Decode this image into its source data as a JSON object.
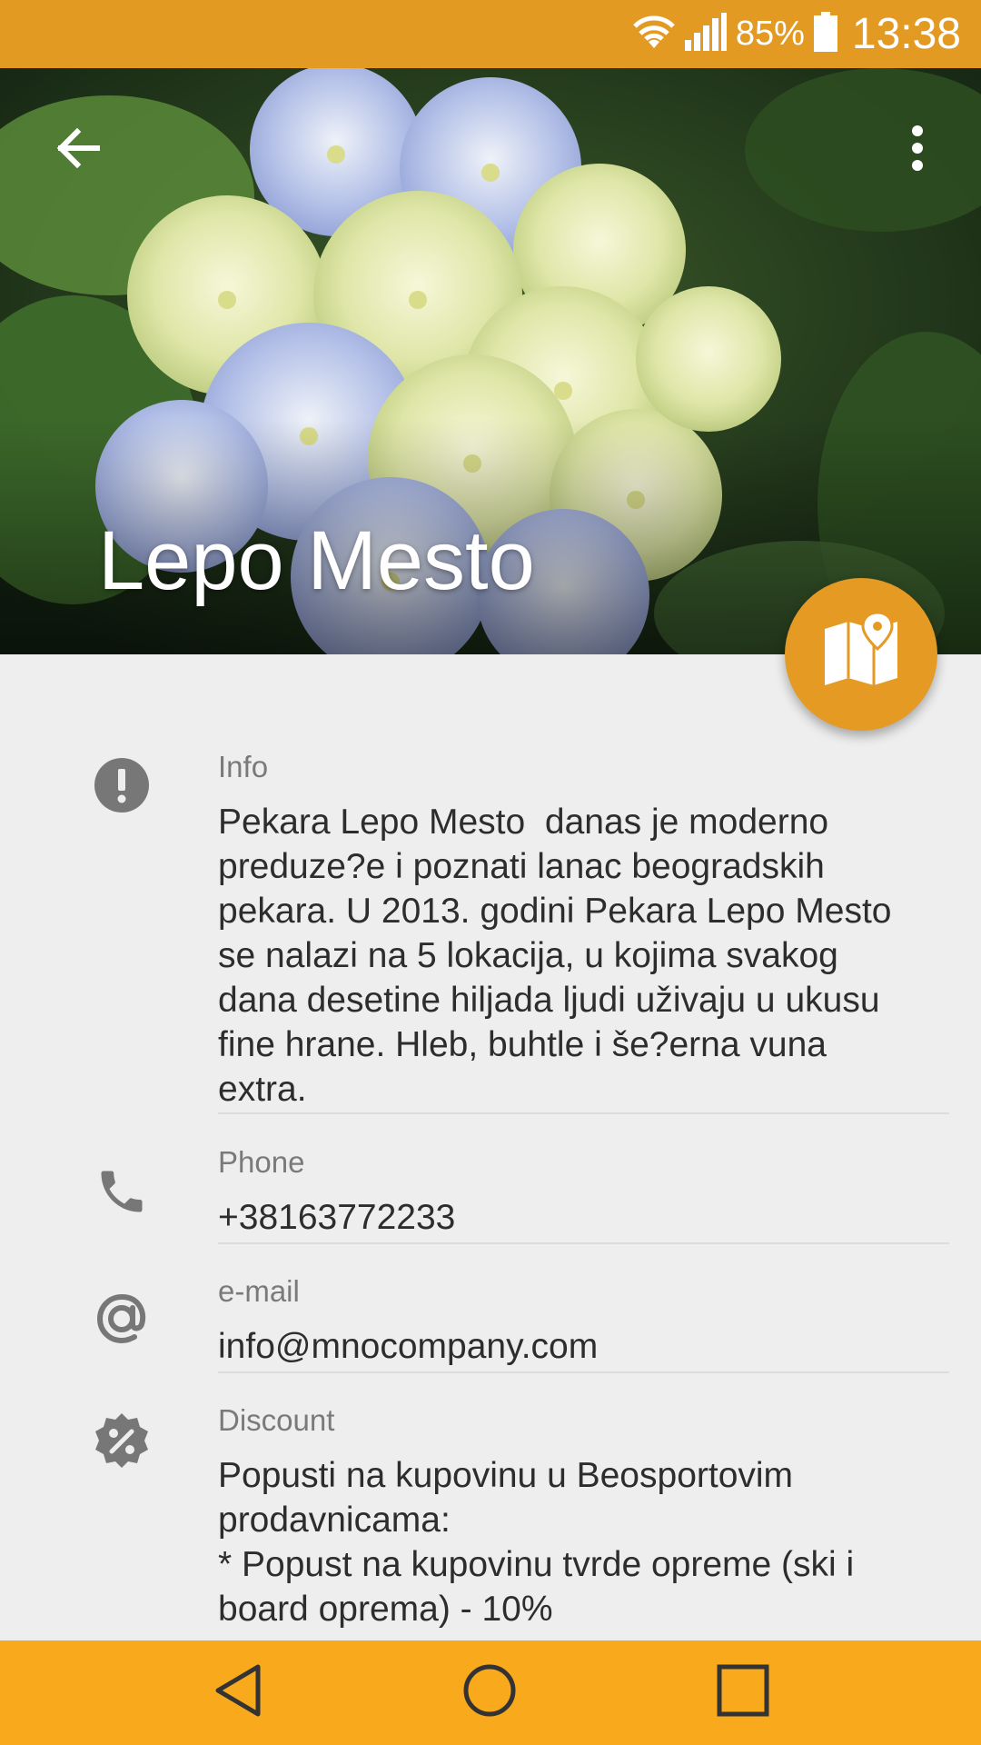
{
  "status_bar": {
    "battery_percent": "85%",
    "time": "13:38",
    "icons": [
      "wifi-icon",
      "signal-icon",
      "battery-icon"
    ],
    "color": "#e39a23"
  },
  "header": {
    "title": "Lepo Mesto",
    "back_icon": "arrow-back-icon",
    "menu_icon": "more-vert-icon",
    "image": "blue and white hydrangea flowers"
  },
  "fab": {
    "icon": "map-icon",
    "color": "#e59a24"
  },
  "details": {
    "info": {
      "icon": "alert-circle-icon",
      "label": "Info",
      "value": "Pekara Lepo Mesto  danas je moderno\npreduze?e i poznati lanac beogradskih\npekara. U 2013. godini Pekara Lepo Mesto\nse nalazi na 5 lokacija, u kojima svakog\ndana desetine hiljada ljudi uživaju u ukusu\nfine hrane. Hleb, buhtle i še?erna vuna\nextra."
    },
    "phone": {
      "icon": "phone-icon",
      "label": "Phone",
      "value": "+38163772233"
    },
    "email": {
      "icon": "at-sign-icon",
      "label": "e-mail",
      "value": "info@mnocompany.com"
    },
    "discount": {
      "icon": "discount-badge-icon",
      "label": "Discount",
      "value": "Popusti na kupovinu u Beosportovim\nprodavnicama:\n* Popust na kupovinu tvrde opreme (ski i\nboard oprema) - 10%"
    }
  },
  "nav_bar": {
    "color": "#f8aa1c",
    "buttons": [
      "nav-back-icon",
      "nav-home-icon",
      "nav-recents-icon"
    ]
  }
}
